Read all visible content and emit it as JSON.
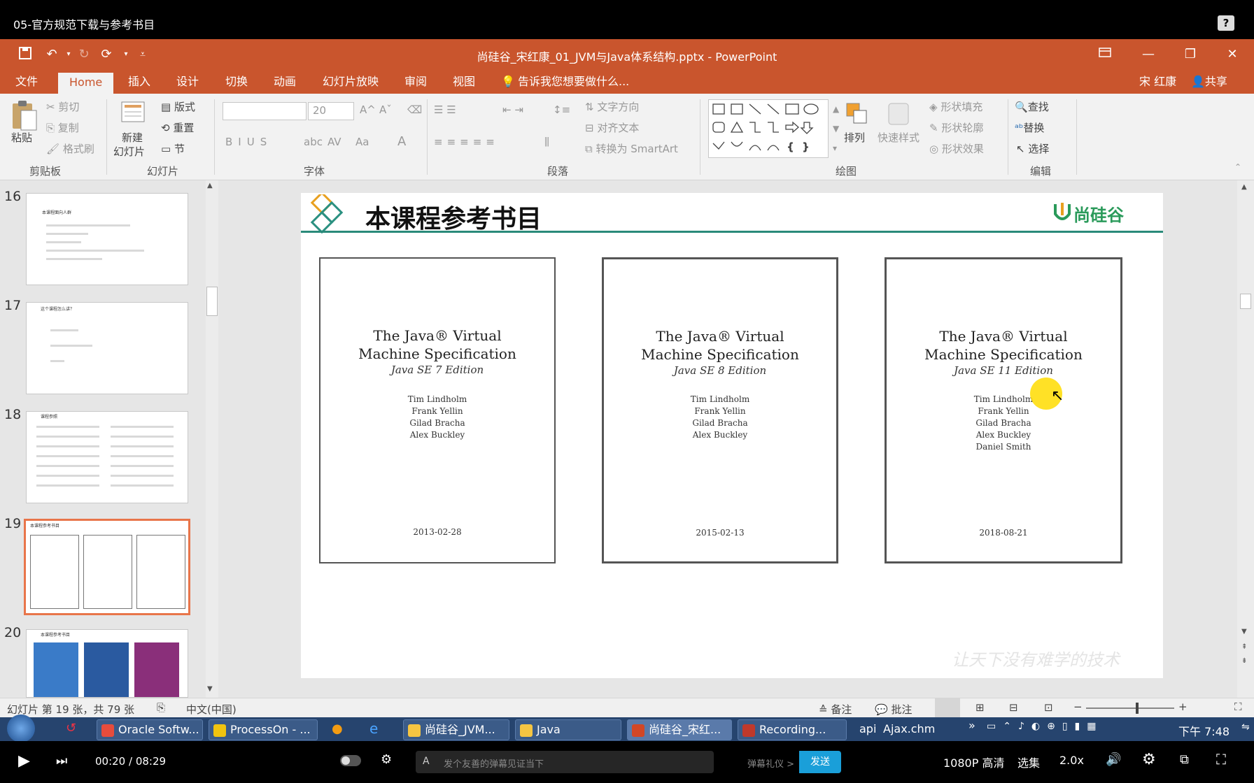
{
  "video": {
    "title": "05-官方规范下载与参考书目",
    "help_label": "?"
  },
  "ppt": {
    "document_title": "尚硅谷_宋红康_01_JVM与Java体系结构.pptx - PowerPoint",
    "user": "宋 红康",
    "share": "共享",
    "tabs": [
      "文件",
      "Home",
      "插入",
      "设计",
      "切换",
      "动画",
      "幻灯片放映",
      "审阅",
      "视图"
    ],
    "tell_me": "告诉我您想要做什么...",
    "ribbon": {
      "paste": "粘贴",
      "cut": "剪切",
      "copy": "复制",
      "format_painter": "格式刷",
      "group_clipboard": "剪贴板",
      "new_slide": "新建",
      "new_slide2": "幻灯片",
      "layout": "版式",
      "reset": "重置",
      "section": "节",
      "group_slides": "幻灯片",
      "font_size": "20",
      "group_font": "字体",
      "text_direction": "文字方向",
      "align_text": "对齐文本",
      "convert_smartart": "转换为 SmartArt",
      "group_paragraph": "段落",
      "arrange": "排列",
      "quick_styles": "快速样式",
      "shape_fill": "形状填充",
      "shape_outline": "形状轮廓",
      "shape_effects": "形状效果",
      "group_drawing": "绘图",
      "find": "查找",
      "replace": "替换",
      "select": "选择",
      "group_editing": "编辑"
    },
    "thumbnails": [
      {
        "num": "16",
        "title": "本课程面向人群"
      },
      {
        "num": "17",
        "title": "这个课程怎么讲？"
      },
      {
        "num": "18",
        "title": "课程参照"
      },
      {
        "num": "19",
        "title": "本课程参考书目"
      },
      {
        "num": "20",
        "title": "本课程参考书目"
      }
    ],
    "slide": {
      "title": "本课程参考书目",
      "logo": "尚硅谷",
      "slogan": "让天下没有难学的技术",
      "books": [
        {
          "title1": "The Java® Virtual",
          "title2": "Machine Specification",
          "edition": "Java SE 7 Edition",
          "authors": [
            "Tim Lindholm",
            "Frank Yellin",
            "Gilad Bracha",
            "Alex Buckley"
          ],
          "date": "2013-02-28"
        },
        {
          "title1": "The Java® Virtual",
          "title2": "Machine Specification",
          "edition": "Java SE 8 Edition",
          "authors": [
            "Tim Lindholm",
            "Frank Yellin",
            "Gilad Bracha",
            "Alex Buckley"
          ],
          "date": "2015-02-13"
        },
        {
          "title1": "The Java® Virtual",
          "title2": "Machine Specification",
          "edition": "Java SE 11 Edition",
          "authors": [
            "Tim Lindholm",
            "Frank Yellin",
            "Gilad Bracha",
            "Alex Buckley",
            "Daniel Smith"
          ],
          "date": "2018-08-21"
        }
      ]
    },
    "status": {
      "slide_info": "幻灯片 第 19 张，共 79 张",
      "language": "中文(中国)",
      "notes": "备注",
      "comments": "批注",
      "zoom_value": 0.58
    }
  },
  "taskbar": {
    "items": [
      {
        "label": "Oracle Softw...",
        "color": "#e74c3c"
      },
      {
        "label": "ProcessOn - ...",
        "color": "#f1c40f"
      },
      {
        "label": "尚硅谷_JVM...",
        "color": "#f5c542"
      },
      {
        "label": "Java",
        "color": "#f5c542"
      },
      {
        "label": "尚硅谷_宋红...",
        "color": "#d24726"
      },
      {
        "label": "Recording...",
        "color": "#c0392b"
      }
    ],
    "tray_api": "api",
    "tray_ajax": "Ajax.chm",
    "clock": "下午 7:48"
  },
  "player": {
    "time": "00:20 / 08:29",
    "danmu_placeholder": "发个友善的弹幕见证当下",
    "danmu_etiquette": "弹幕礼仪 >",
    "send": "发送",
    "quality": "1080P 高清",
    "episodes": "选集",
    "speed": "2.0x"
  }
}
